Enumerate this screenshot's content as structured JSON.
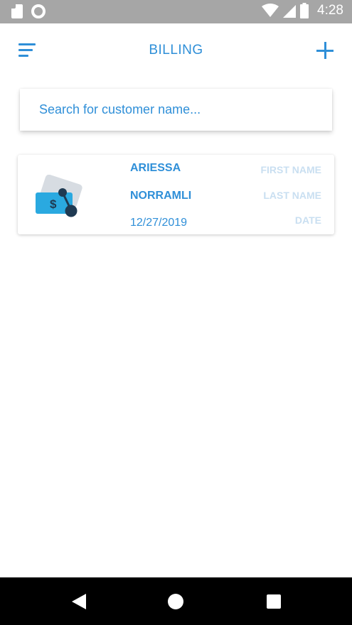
{
  "status_bar": {
    "time": "4:28"
  },
  "app_bar": {
    "title": "BILLING"
  },
  "search": {
    "placeholder": "Search for customer name..."
  },
  "billing_list": [
    {
      "first_name": "ARIESSA",
      "first_name_label": "FIRST NAME",
      "last_name": "NORRAMLI",
      "last_name_label": "LAST NAME",
      "date": "12/27/2019",
      "date_label": "DATE"
    }
  ],
  "colors": {
    "accent": "#2f8fd8",
    "label_muted": "#c9dff1",
    "status_bar": "#a6a6a6",
    "nav_bar": "#000000"
  },
  "icons": [
    "sd-card-icon",
    "circle-icon",
    "wifi-icon",
    "signal-icon",
    "battery-icon",
    "menu-icon",
    "add-icon",
    "money-icon",
    "back-icon",
    "home-icon",
    "recents-icon"
  ]
}
